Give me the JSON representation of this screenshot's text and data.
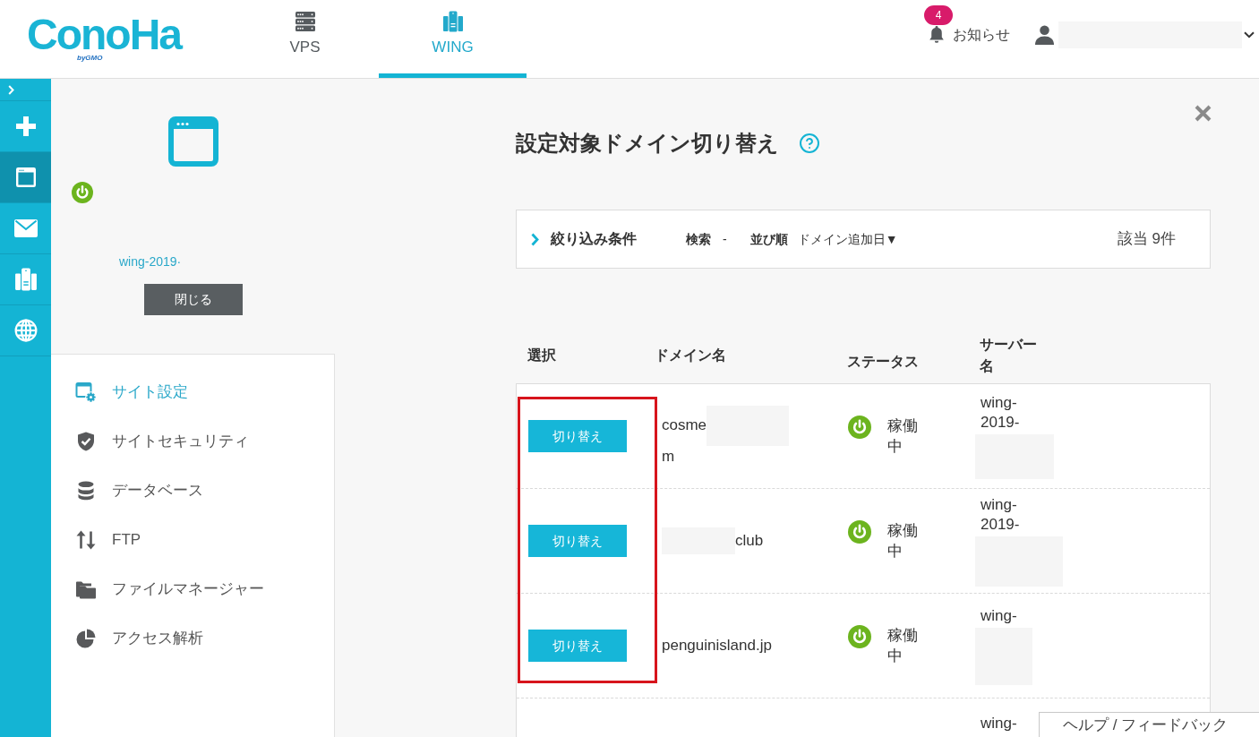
{
  "header": {
    "logo": {
      "wordmark": "ConoHa",
      "tagline": "byGMO"
    },
    "tabs": [
      {
        "label": "VPS",
        "kind": "vps",
        "selected": false
      },
      {
        "label": "WING",
        "kind": "wing",
        "selected": true
      }
    ],
    "notifications": {
      "label": "お知らせ",
      "count": "4"
    }
  },
  "rail": [
    {
      "kind": "plus",
      "selected": false
    },
    {
      "kind": "window",
      "selected": true
    },
    {
      "kind": "mail",
      "selected": false
    },
    {
      "kind": "wing",
      "selected": false
    },
    {
      "kind": "globe",
      "selected": false
    }
  ],
  "site_card": {
    "status": {
      "kind": "running"
    },
    "name": "wing-2019·",
    "button": "閉じる"
  },
  "menu": [
    {
      "label": "サイト設定",
      "kind": "site",
      "selected": true
    },
    {
      "label": "サイトセキュリティ",
      "kind": "security",
      "selected": false
    },
    {
      "label": "データベース",
      "kind": "database",
      "selected": false
    },
    {
      "label": "FTP",
      "kind": "ftp",
      "selected": false
    },
    {
      "label": "ファイルマネージャー",
      "kind": "files",
      "selected": false
    },
    {
      "label": "アクセス解析",
      "kind": "analytics",
      "selected": false
    }
  ],
  "main": {
    "title": "設定対象ドメイン切り替え",
    "filter": {
      "toggle": "絞り込み条件",
      "search_label": "検索",
      "search_value": "-",
      "sort_label": "並び順",
      "sort_value": "ドメイン追加日▼",
      "count": "該当 9件"
    },
    "table": {
      "columns": [
        "選択",
        "ドメイン名",
        "ステータス",
        "サーバー名"
      ],
      "rows": [
        {
          "button": "切り替え",
          "domain": [
            {
              "kind": "text",
              "text": "cosme"
            },
            {
              "kind": "redacted"
            },
            {
              "kind": "text",
              "text": "m"
            }
          ],
          "status": {
            "kind": "running",
            "text": "稼働中"
          },
          "server": [
            {
              "kind": "text",
              "text": "wing-2019-"
            },
            {
              "kind": "redacted"
            }
          ],
          "highlighted": true
        },
        {
          "button": "切り替え",
          "domain": [
            {
              "kind": "redacted"
            },
            {
              "kind": "text",
              "text": "club"
            }
          ],
          "status": {
            "kind": "running",
            "text": "稼働中"
          },
          "server": [
            {
              "kind": "text",
              "text": "wing-2019-"
            },
            {
              "kind": "redacted"
            }
          ],
          "highlighted": true
        },
        {
          "button": "切り替え",
          "domain": [
            {
              "kind": "text",
              "text": "penguinisland.jp"
            }
          ],
          "status": {
            "kind": "running",
            "text": "稼働中"
          },
          "server": [
            {
              "kind": "text",
              "text": "wing-"
            },
            {
              "kind": "redacted"
            }
          ],
          "highlighted": true
        },
        {
          "server": [
            {
              "kind": "text",
              "text": "wing-"
            }
          ]
        }
      ]
    },
    "help_button": "ヘルプ / フィードバック"
  }
}
